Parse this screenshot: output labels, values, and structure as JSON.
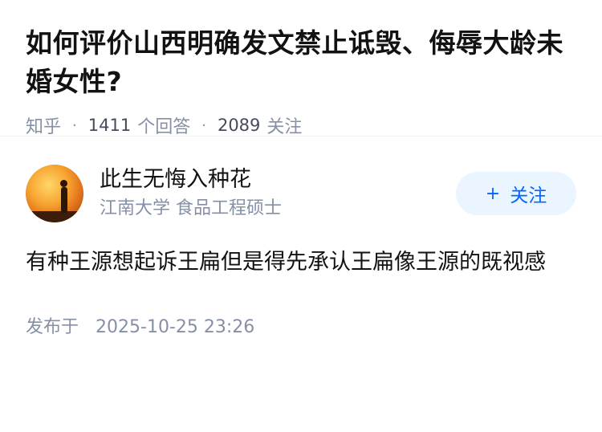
{
  "question": {
    "title": "如何评价山西明确发文禁止诋毁、侮辱大龄未婚女性?",
    "source": "知乎",
    "answer_count": "1411",
    "answer_unit": "个回答",
    "follower_count": "2089",
    "follower_unit": "关注"
  },
  "answer": {
    "author_name": "此生无悔入种花",
    "author_desc": "江南大学 食品工程硕士",
    "follow_label": "关注",
    "follow_icon": "plus-icon",
    "content": "有种王源想起诉王扁但是得先承认王扁像王源的既视感",
    "published_label": "发布于",
    "published_time": "2025-10-25 23:26"
  },
  "colors": {
    "accent": "#0066ff",
    "follow_bg": "#ebf5ff",
    "meta_gray": "#8590a6"
  }
}
